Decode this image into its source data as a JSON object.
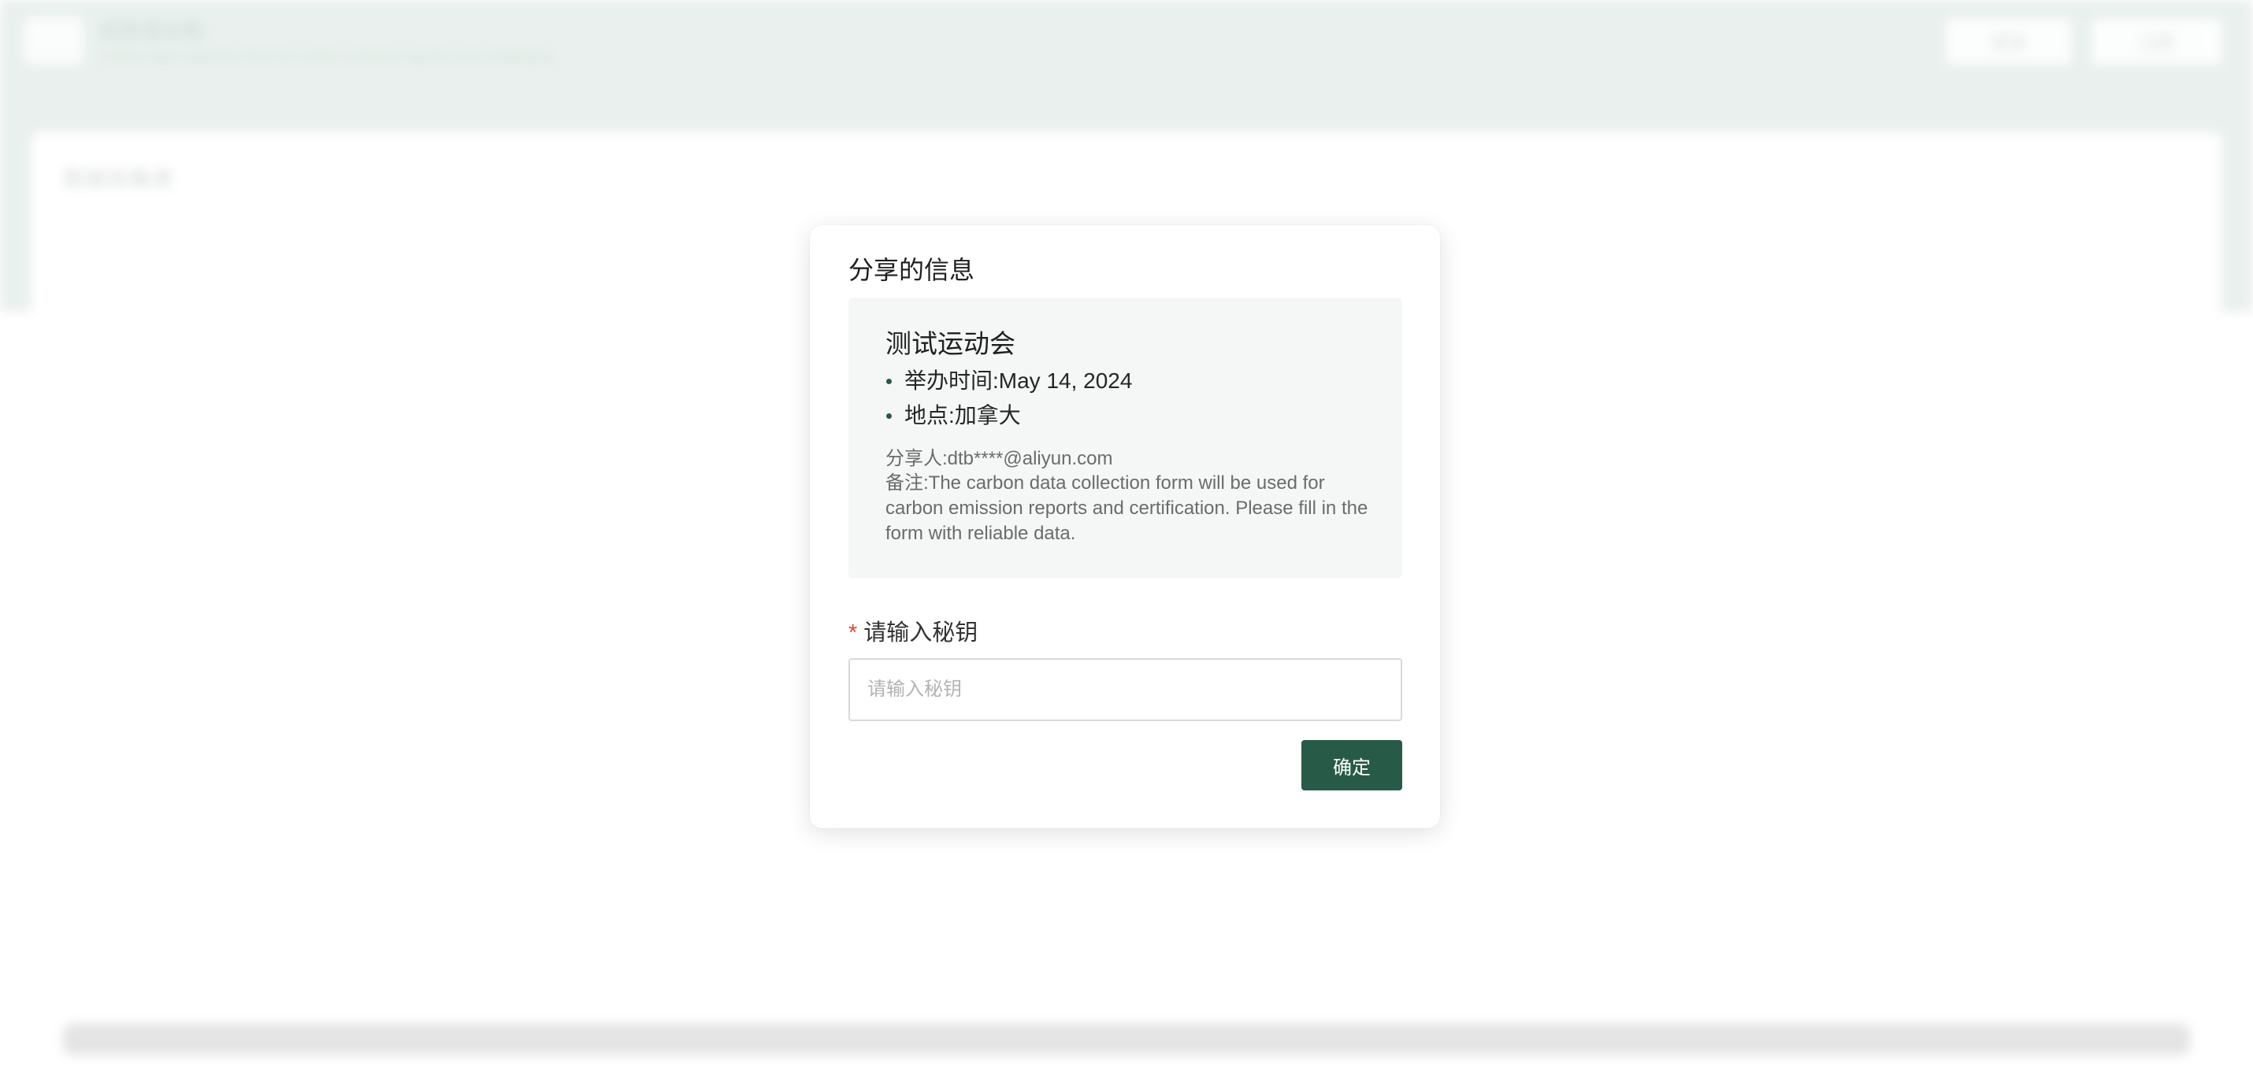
{
  "background": {
    "app_title": "碳数据采集",
    "app_subtitle": "Carbon data collection form for carbon emission reports and certification",
    "header_buttons": [
      "登录",
      "注册"
    ],
    "card_title": "数据采集表"
  },
  "modal": {
    "title": "分享的信息",
    "event": {
      "name": "测试运动会",
      "details": [
        "举办时间:May 14, 2024",
        "地点:加拿大"
      ],
      "sharer": "分享人:dtb****@aliyun.com",
      "remark": "备注:The carbon data collection form will be used for carbon emission reports and certification. Please fill in the form with reliable data."
    },
    "secret_field": {
      "required_mark": "*",
      "label": "请输入秘钥",
      "placeholder": "请输入秘钥",
      "value": ""
    },
    "confirm_label": "确定"
  },
  "colors": {
    "primary": "#285a48",
    "header_bg": "#e9f0ed",
    "info_box_bg": "#f5f7f6",
    "required": "#e0443a"
  }
}
